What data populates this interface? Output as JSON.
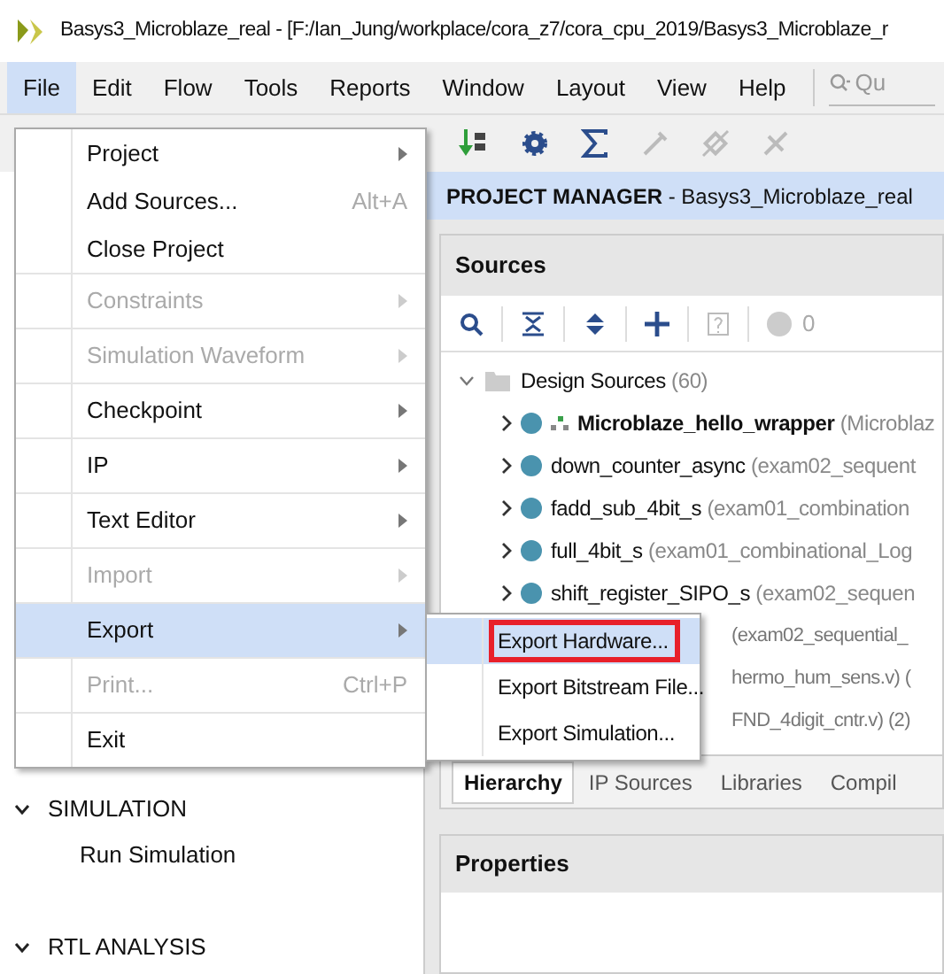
{
  "window": {
    "title": "Basys3_Microblaze_real - [F:/Ian_Jung/workplace/cora_z7/cora_cpu_2019/Basys3_Microblaze_r"
  },
  "menu_bar": {
    "items": [
      {
        "label": "File",
        "selected": true
      },
      {
        "label": "Edit",
        "selected": false
      },
      {
        "label": "Flow",
        "selected": false
      },
      {
        "label": "Tools",
        "selected": false
      },
      {
        "label": "Reports",
        "selected": false
      },
      {
        "label": "Window",
        "selected": false
      },
      {
        "label": "Layout",
        "selected": false
      },
      {
        "label": "View",
        "selected": false
      },
      {
        "label": "Help",
        "selected": false
      }
    ],
    "search": {
      "placeholder": "Qu"
    }
  },
  "flow_navigator": {
    "sections": [
      {
        "label": "SIMULATION",
        "expanded": true,
        "items": [
          "Run Simulation"
        ]
      },
      {
        "label": "RTL ANALYSIS",
        "expanded": true
      }
    ]
  },
  "project_manager": {
    "title": "**PROJECT MANAGER** - Basys3_Microblaze_real"
  },
  "sources": {
    "title": "Sources",
    "warning_count": "0",
    "root": {
      "label": "Design Sources",
      "count": "(60)",
      "expanded": true,
      "children": [
        {
          "kind": "top",
          "name": "Microblaze_hello_wrapper",
          "detail": "(Microblaz"
        },
        {
          "kind": "module",
          "name": "down_counter_async",
          "detail": "(exam02_sequent"
        },
        {
          "kind": "module",
          "name": "fadd_sub_4bit_s",
          "detail": "(exam01_combination"
        },
        {
          "kind": "module",
          "name": "full_4bit_s",
          "detail": "(exam01_combinational_Log"
        },
        {
          "kind": "module",
          "name": "shift_register_SIPO_s",
          "detail": "(exam02_sequen"
        },
        {
          "kind": "covered",
          "detail": "(exam02_sequential_"
        },
        {
          "kind": "covered",
          "detail": "hermo_hum_sens.v) ("
        },
        {
          "kind": "covered",
          "detail": "FND_4digit_cntr.v) (2)"
        }
      ]
    },
    "tabs": [
      {
        "label": "Hierarchy",
        "selected": true
      },
      {
        "label": "IP Sources",
        "selected": false
      },
      {
        "label": "Libraries",
        "selected": false
      },
      {
        "label": "Compil",
        "selected": false
      }
    ]
  },
  "properties": {
    "title": "Properties"
  },
  "file_menu": {
    "items": [
      {
        "label": "Project",
        "submenu": true,
        "disabled": false,
        "selected": false
      },
      {
        "label": "Add Sources...",
        "shortcut": "Alt+A",
        "submenu": false,
        "disabled": false,
        "selected": false
      },
      {
        "label": "Close Project",
        "submenu": false,
        "disabled": false,
        "selected": false
      },
      {
        "label": "Constraints",
        "submenu": true,
        "disabled": true,
        "selected": false
      },
      {
        "label": "Simulation Waveform",
        "submenu": true,
        "disabled": true,
        "selected": false
      },
      {
        "label": "Checkpoint",
        "submenu": true,
        "disabled": false,
        "selected": false
      },
      {
        "label": "IP",
        "submenu": true,
        "disabled": false,
        "selected": false
      },
      {
        "label": "Text Editor",
        "submenu": true,
        "disabled": false,
        "selected": false
      },
      {
        "label": "Import",
        "submenu": true,
        "disabled": true,
        "selected": false
      },
      {
        "label": "Export",
        "submenu": true,
        "disabled": false,
        "selected": true
      },
      {
        "label": "Print...",
        "shortcut": "Ctrl+P",
        "submenu": false,
        "disabled": true,
        "selected": false
      },
      {
        "label": "Exit",
        "submenu": false,
        "disabled": false,
        "selected": false
      }
    ]
  },
  "export_submenu": {
    "items": [
      {
        "label": "Export Hardware...",
        "selected": true
      },
      {
        "label": "Export Bitstream File...",
        "selected": false
      },
      {
        "label": "Export Simulation...",
        "selected": false
      }
    ]
  }
}
